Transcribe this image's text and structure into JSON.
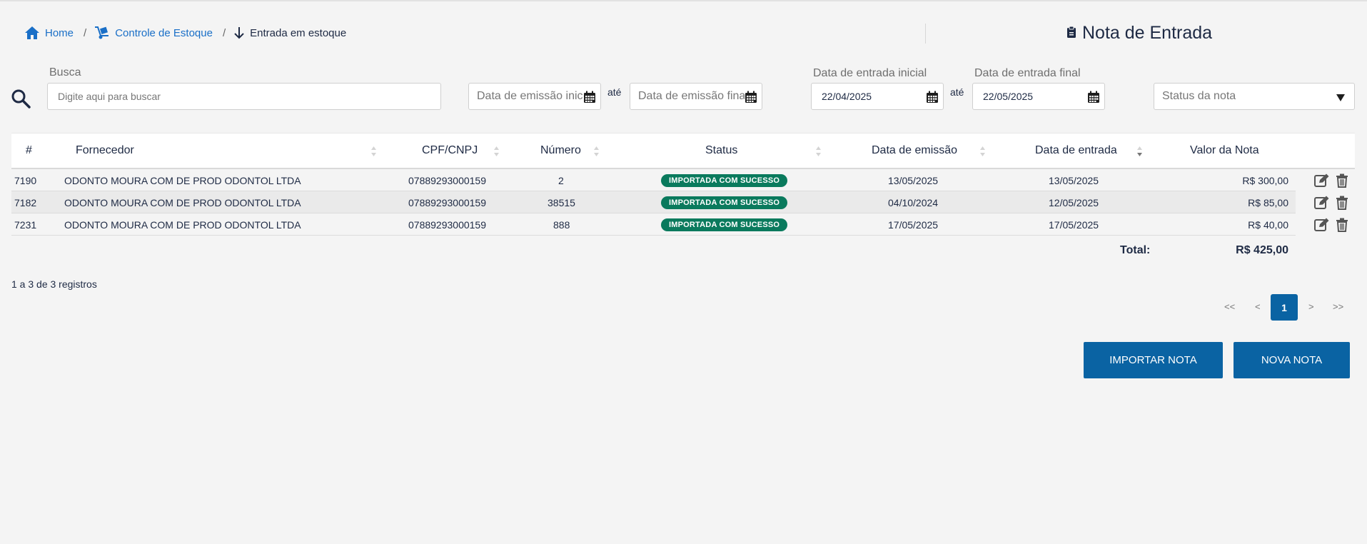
{
  "breadcrumb": {
    "home": "Home",
    "stock": "Controle de Estoque",
    "current": "Entrada em estoque",
    "separator": "/"
  },
  "page_title": "Nota de Entrada",
  "filters": {
    "search_label": "Busca",
    "search_placeholder": "Digite aqui para buscar",
    "emission_start_placeholder": "Data de emissão inicial",
    "emission_end_placeholder": "Data de emissão final",
    "ate": "até",
    "entry_start_label": "Data de entrada inicial",
    "entry_start_value": "22/04/2025",
    "entry_end_label": "Data de entrada final",
    "entry_end_value": "22/05/2025",
    "status_placeholder": "Status da nota"
  },
  "table": {
    "headers": [
      "#",
      "Fornecedor",
      "CPF/CNPJ",
      "Número",
      "Status",
      "Data de emissão",
      "Data de entrada",
      "Valor da Nota"
    ],
    "rows": [
      {
        "id": "7190",
        "fornecedor": "ODONTO MOURA COM DE PROD ODONTOL LTDA",
        "cnpj": "07889293000159",
        "numero": "2",
        "status": "IMPORTADA COM SUCESSO",
        "emissao": "13/05/2025",
        "entrada": "13/05/2025",
        "valor": "R$ 300,00"
      },
      {
        "id": "7182",
        "fornecedor": "ODONTO MOURA COM DE PROD ODONTOL LTDA",
        "cnpj": "07889293000159",
        "numero": "38515",
        "status": "IMPORTADA COM SUCESSO",
        "emissao": "04/10/2024",
        "entrada": "12/05/2025",
        "valor": "R$ 85,00"
      },
      {
        "id": "7231",
        "fornecedor": "ODONTO MOURA COM DE PROD ODONTOL LTDA",
        "cnpj": "07889293000159",
        "numero": "888",
        "status": "IMPORTADA COM SUCESSO",
        "emissao": "17/05/2025",
        "entrada": "17/05/2025",
        "valor": "R$ 40,00"
      }
    ],
    "total_label": "Total:",
    "total_value": "R$ 425,00"
  },
  "records_info": "1 a 3 de 3 registros",
  "pagination": {
    "first": "<<",
    "prev": "<",
    "current": "1",
    "next": ">",
    "last": ">>"
  },
  "buttons": {
    "import": "IMPORTAR NOTA",
    "new": "NOVA NOTA"
  },
  "colors": {
    "primary": "#0a63a3",
    "link": "#1a6fc7",
    "success": "#0a7a5d",
    "text": "#1e2a44"
  },
  "icons": {
    "home": "home-icon",
    "stock": "dolly-icon",
    "entry": "arrow-down-icon",
    "title": "clipboard-icon",
    "search": "search-icon",
    "calendar": "calendar-icon",
    "edit": "edit-icon",
    "delete": "trash-icon"
  }
}
